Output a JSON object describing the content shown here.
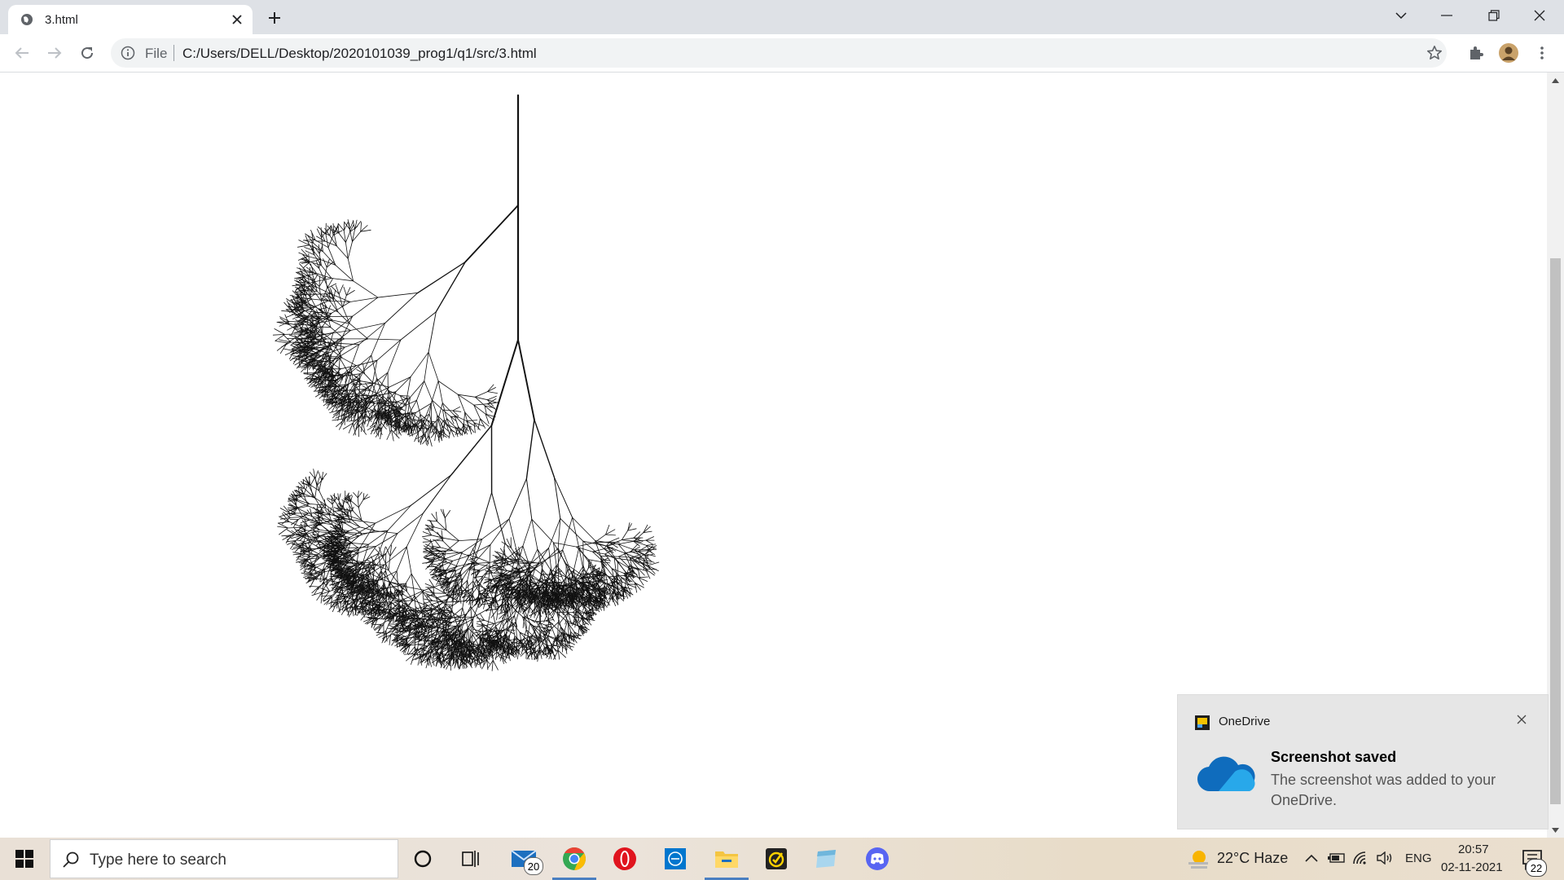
{
  "browser": {
    "tab_title": "3.html",
    "address_scheme": "File",
    "address_url": "C:/Users/DELL/Desktop/2020101039_prog1/q1/src/3.html"
  },
  "notification": {
    "app_name": "OneDrive",
    "heading": "Screenshot saved",
    "body": "The screenshot was added to your OneDrive."
  },
  "taskbar": {
    "search_placeholder": "Type here to search",
    "mail_badge": "20",
    "weather": "22°C  Haze",
    "language": "ENG",
    "time": "20:57",
    "date": "02-11-2021",
    "notification_count": "22"
  },
  "colors": {
    "tabstrip": "#dee1e6",
    "toast_bg": "#e6e6e6",
    "accent": "#4a7fc1",
    "chrome_red": "#ea4335",
    "chrome_green": "#34a853",
    "chrome_yellow": "#fbbc05",
    "chrome_blue": "#4285f4",
    "opera_red": "#e0141e",
    "discord": "#5865f2",
    "onedrive_blue": "#0f6cbd"
  }
}
